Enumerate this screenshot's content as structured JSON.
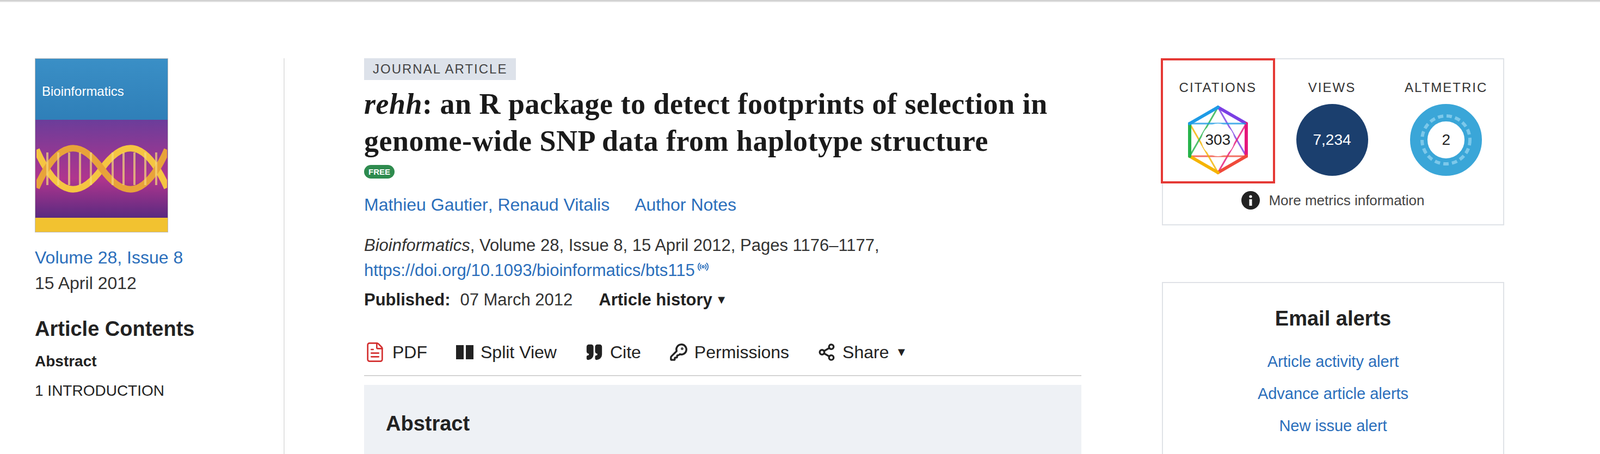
{
  "journal": {
    "cover_title": "Bioinformatics",
    "volume_link": "Volume 28, Issue 8",
    "issue_date": "15 April 2012"
  },
  "contents": {
    "heading": "Article Contents",
    "items": [
      {
        "label": "Abstract",
        "selected": true
      },
      {
        "label": "1 INTRODUCTION",
        "selected": false
      }
    ]
  },
  "article": {
    "type": "JOURNAL ARTICLE",
    "title_italic": "rehh",
    "title_rest": ": an R package to detect footprints of selection in genome-wide SNP data from haplotype structure",
    "access_badge": "FREE",
    "authors": [
      "Mathieu Gautier",
      "Renaud Vitalis"
    ],
    "author_separator": ", ",
    "author_notes": "Author Notes",
    "citation_journal": "Bioinformatics",
    "citation_rest": ", Volume 28, Issue 8, 15 April 2012, Pages 1176–1177,",
    "doi": "https://doi.org/10.1093/bioinformatics/bts115",
    "published_label": "Published:",
    "published_date": "07 March 2012",
    "history": "Article history",
    "history_caret": "▼"
  },
  "toolbar": [
    {
      "label": "PDF",
      "kind": "pdf",
      "caret": ""
    },
    {
      "label": "Split View",
      "kind": "split",
      "caret": ""
    },
    {
      "label": "Cite",
      "kind": "cite",
      "caret": ""
    },
    {
      "label": "Permissions",
      "kind": "key",
      "caret": ""
    },
    {
      "label": "Share",
      "kind": "share",
      "caret": "▼"
    }
  ],
  "abstract": {
    "heading": "Abstract"
  },
  "metrics": {
    "items": [
      {
        "label": "CITATIONS",
        "value": "303",
        "kind": "dimensions",
        "highlighted": true
      },
      {
        "label": "VIEWS",
        "value": "7,234",
        "kind": "views",
        "highlighted": false
      },
      {
        "label": "ALTMETRIC",
        "value": "2",
        "kind": "altmetric",
        "highlighted": false
      }
    ],
    "more": "More metrics information"
  },
  "email_alerts": {
    "heading": "Email alerts",
    "links": [
      "Article activity alert",
      "Advance article alerts",
      "New issue alert"
    ]
  }
}
